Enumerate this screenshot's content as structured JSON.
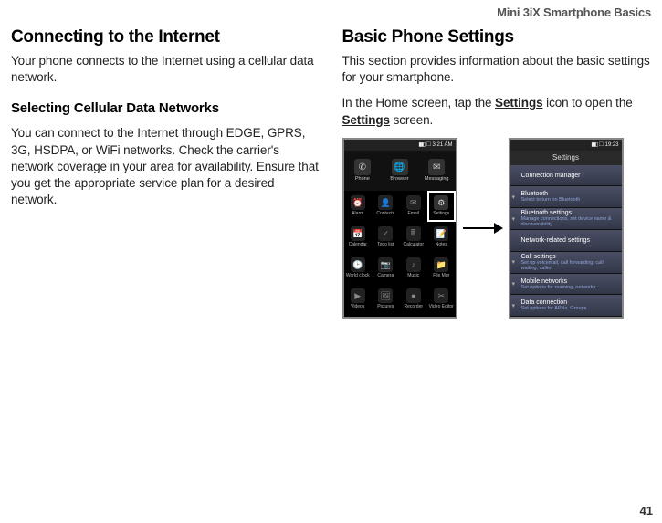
{
  "header": "Mini 3iX Smartphone Basics",
  "page": "41",
  "left": {
    "h1": "Connecting to the Internet",
    "p1": "Your phone connects to the Internet using a cellular data network.",
    "h2": "Selecting Cellular Data Networks",
    "p2": "You can connect to the Internet through EDGE, GPRS, 3G, HSDPA, or WiFi networks. Check the carrier's network coverage in your area for availability. Ensure that you get the appropriate service plan for a desired network."
  },
  "right": {
    "h1": "Basic Phone Settings",
    "p1": "This section provides information about the basic settings for your smartphone.",
    "p2a": "In the Home screen, tap the ",
    "p2b": "Settings",
    "p2c": " icon to open the ",
    "p2d": "Settings",
    "p2e": " screen."
  },
  "home": {
    "time": "3:21 AM",
    "top": [
      {
        "label": "Phone",
        "glyph": "✆"
      },
      {
        "label": "Browser",
        "glyph": "🌐"
      },
      {
        "label": "Messaging",
        "glyph": "✉"
      }
    ],
    "grid": [
      {
        "label": "Alarm",
        "glyph": "⏰"
      },
      {
        "label": "Contacts",
        "glyph": "👤"
      },
      {
        "label": "Email",
        "glyph": "✉"
      },
      {
        "label": "Settings",
        "glyph": "⚙",
        "highlight": true
      },
      {
        "label": "Calendar",
        "glyph": "📅"
      },
      {
        "label": "Todo list",
        "glyph": "✓"
      },
      {
        "label": "Calculator",
        "glyph": "🖩"
      },
      {
        "label": "Notes",
        "glyph": "📝"
      },
      {
        "label": "World clock",
        "glyph": "🕑"
      },
      {
        "label": "Camera",
        "glyph": "📷"
      },
      {
        "label": "Music",
        "glyph": "♪"
      },
      {
        "label": "File Mgr",
        "glyph": "📁"
      },
      {
        "label": "Videos",
        "glyph": "▶"
      },
      {
        "label": "Pictures",
        "glyph": "🖼"
      },
      {
        "label": "Recorder",
        "glyph": "●"
      },
      {
        "label": "Video Editor",
        "glyph": "✂"
      }
    ]
  },
  "settings": {
    "time": "19:23",
    "title": "Settings",
    "items": [
      {
        "title": "Connection manager",
        "sub": ""
      },
      {
        "title": "Bluetooth",
        "sub": "Select to turn on Bluetooth"
      },
      {
        "title": "Bluetooth settings",
        "sub": "Manage connections, set device name & discoverability"
      },
      {
        "title": "Network-related settings",
        "sub": ""
      },
      {
        "title": "Call settings",
        "sub": "Set up voicemail, call forwarding, call waiting, caller"
      },
      {
        "title": "Mobile networks",
        "sub": "Set options for roaming, networks"
      },
      {
        "title": "Data connection",
        "sub": "Set options for APNs, Groups"
      }
    ]
  }
}
